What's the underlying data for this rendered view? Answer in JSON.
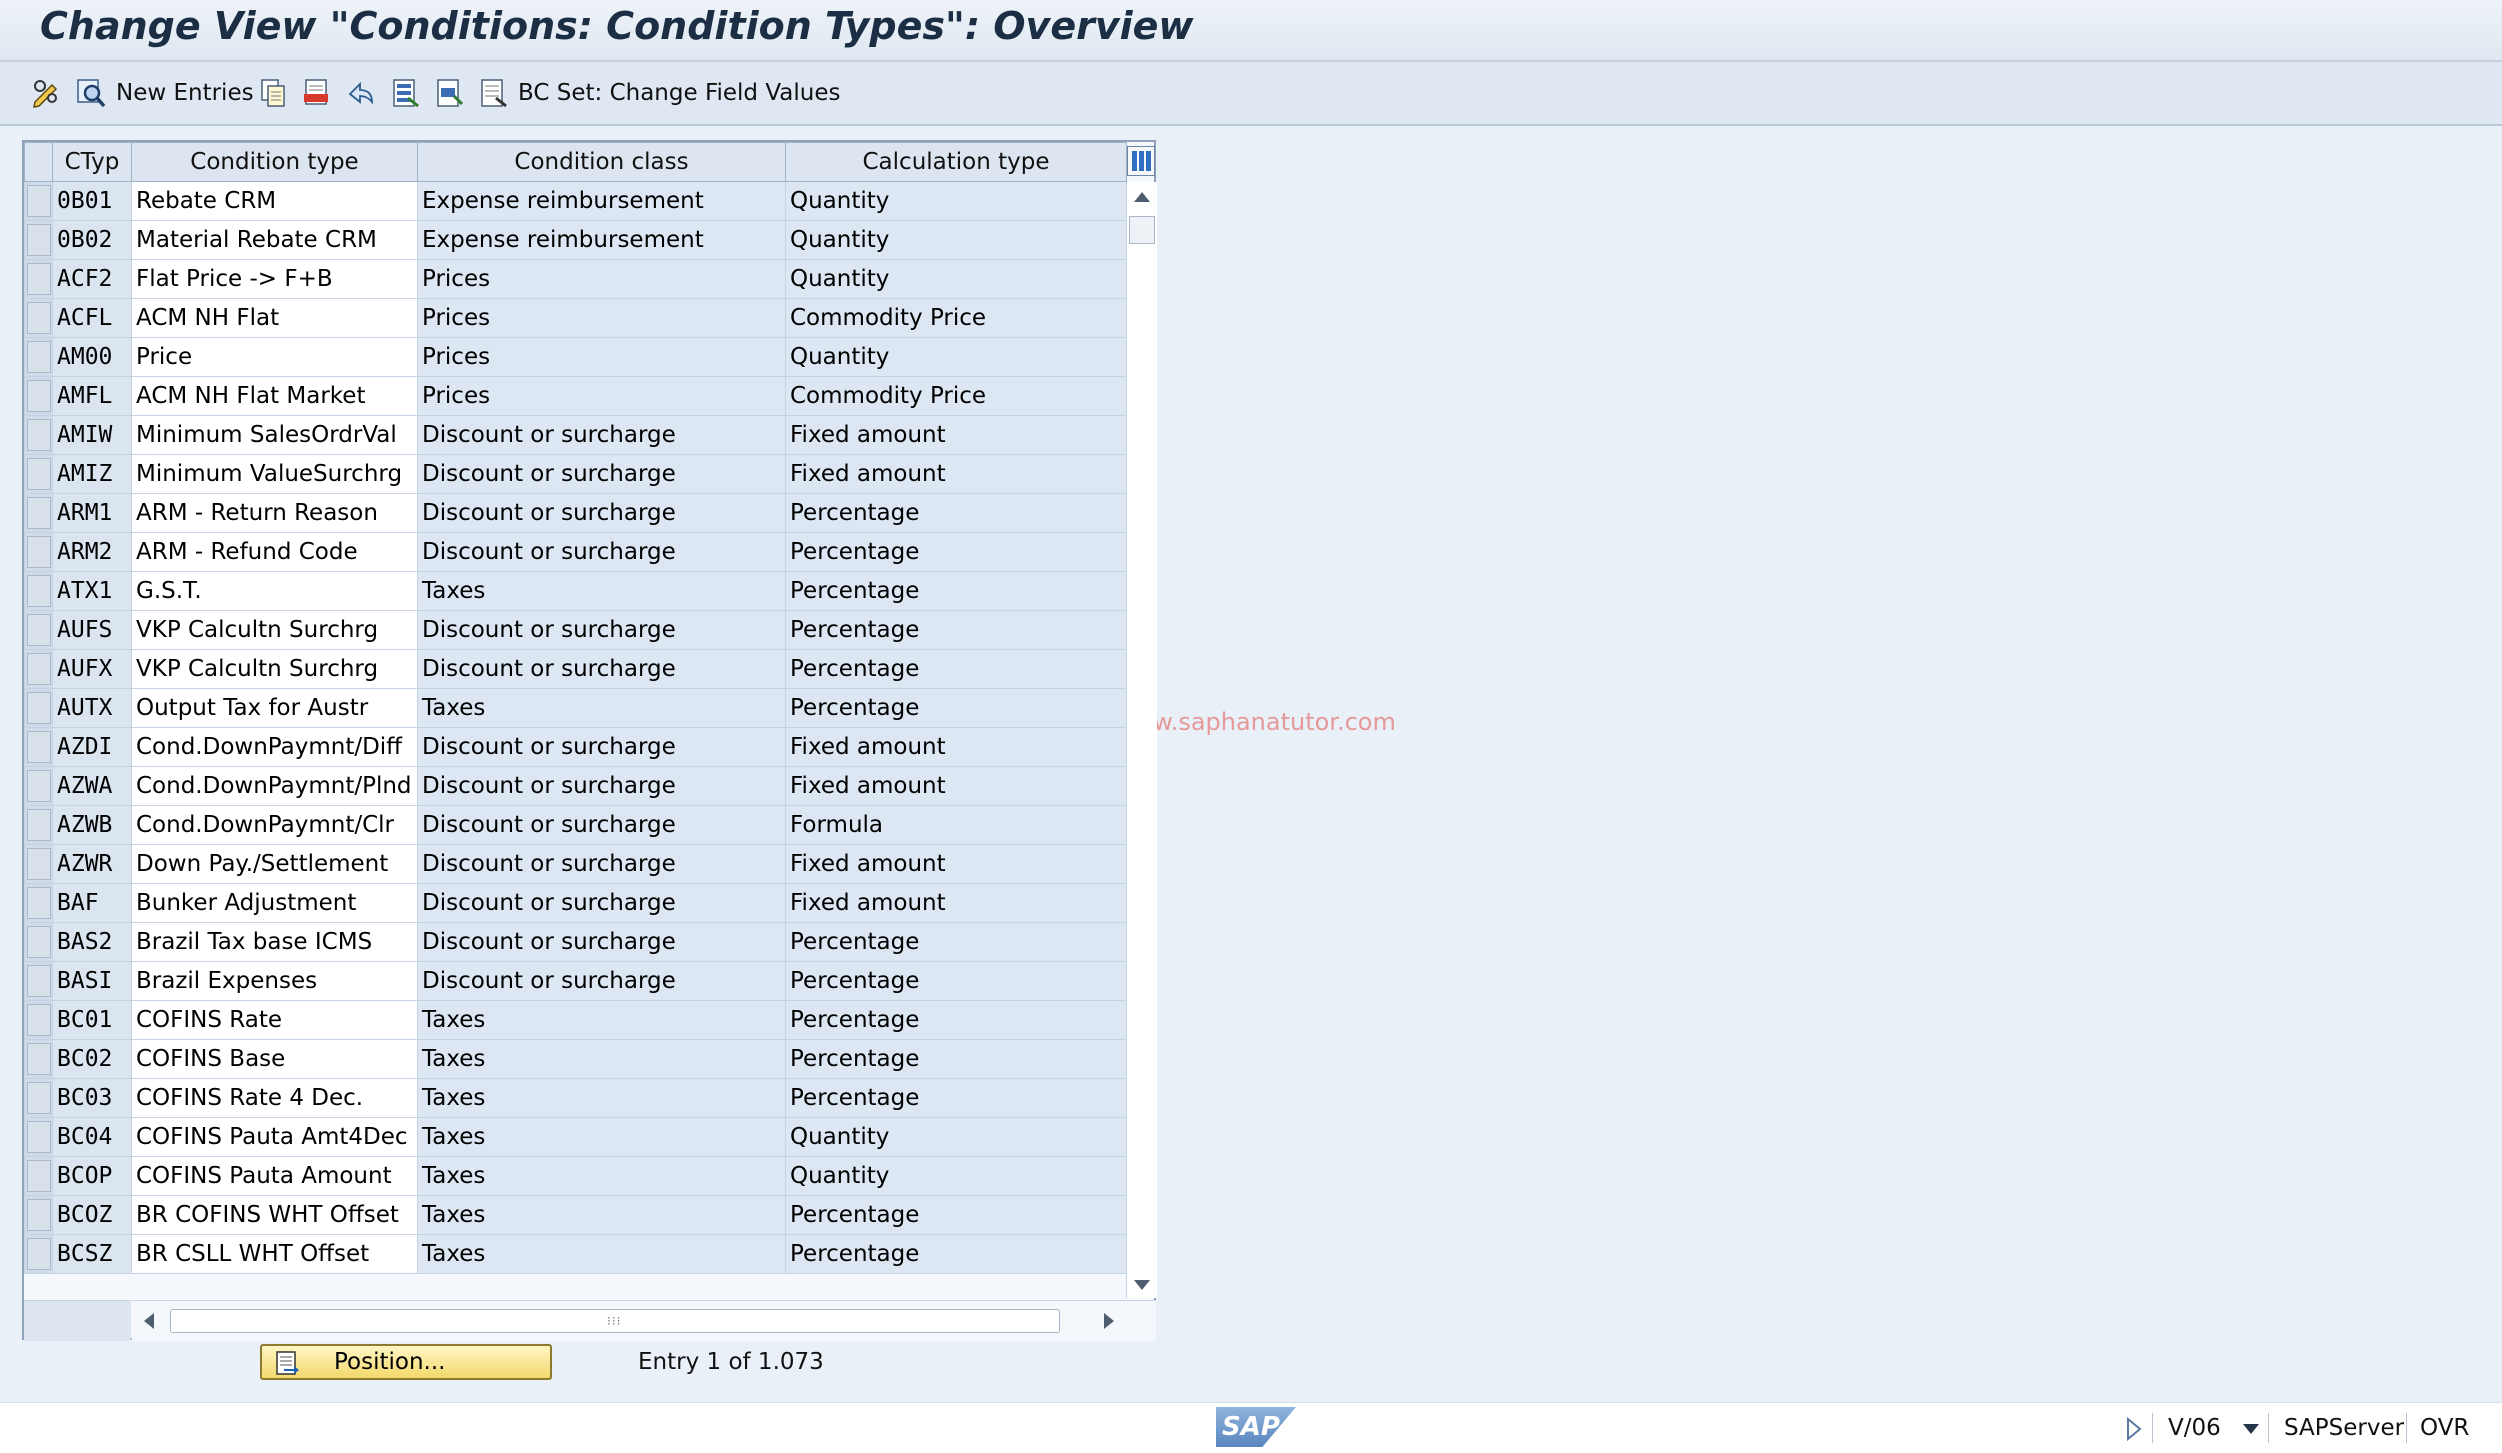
{
  "window": {
    "title": "Change View \"Conditions: Condition Types\": Overview"
  },
  "toolbar": {
    "new_entries_label": "New Entries",
    "bc_set_label": "BC Set: Change Field Values"
  },
  "table": {
    "headers": [
      "CTyp",
      "Condition type",
      "Condition class",
      "Calculation type"
    ],
    "rows": [
      [
        "0B01",
        "Rebate CRM",
        "Expense reimbursement",
        "Quantity"
      ],
      [
        "0B02",
        "Material Rebate CRM",
        "Expense reimbursement",
        "Quantity"
      ],
      [
        "ACF2",
        "Flat Price -> F+B",
        "Prices",
        "Quantity"
      ],
      [
        "ACFL",
        "ACM NH Flat",
        "Prices",
        "Commodity Price"
      ],
      [
        "AM00",
        "Price",
        "Prices",
        "Quantity"
      ],
      [
        "AMFL",
        "ACM NH Flat Market",
        "Prices",
        "Commodity Price"
      ],
      [
        "AMIW",
        "Minimum SalesOrdrVal",
        "Discount or surcharge",
        "Fixed amount"
      ],
      [
        "AMIZ",
        "Minimum ValueSurchrg",
        "Discount or surcharge",
        "Fixed amount"
      ],
      [
        "ARM1",
        "ARM - Return Reason",
        "Discount or surcharge",
        "Percentage"
      ],
      [
        "ARM2",
        "ARM - Refund Code",
        "Discount or surcharge",
        "Percentage"
      ],
      [
        "ATX1",
        "G.S.T.",
        "Taxes",
        "Percentage"
      ],
      [
        "AUFS",
        "VKP Calcultn Surchrg",
        "Discount or surcharge",
        "Percentage"
      ],
      [
        "AUFX",
        "VKP Calcultn Surchrg",
        "Discount or surcharge",
        "Percentage"
      ],
      [
        "AUTX",
        "Output Tax for Austr",
        "Taxes",
        "Percentage"
      ],
      [
        "AZDI",
        "Cond.DownPaymnt/Diff",
        "Discount or surcharge",
        "Fixed amount"
      ],
      [
        "AZWA",
        "Cond.DownPaymnt/Plnd",
        "Discount or surcharge",
        "Fixed amount"
      ],
      [
        "AZWB",
        "Cond.DownPaymnt/Clr",
        "Discount or surcharge",
        "Formula"
      ],
      [
        "AZWR",
        "Down Pay./Settlement",
        "Discount or surcharge",
        "Fixed amount"
      ],
      [
        "BAF",
        "Bunker Adjustment",
        "Discount or surcharge",
        "Fixed amount"
      ],
      [
        "BAS2",
        "Brazil Tax base ICMS",
        "Discount or surcharge",
        "Percentage"
      ],
      [
        "BASI",
        "Brazil Expenses",
        "Discount or surcharge",
        "Percentage"
      ],
      [
        "BC01",
        "COFINS Rate",
        "Taxes",
        "Percentage"
      ],
      [
        "BC02",
        "COFINS Base",
        "Taxes",
        "Percentage"
      ],
      [
        "BC03",
        "COFINS Rate 4 Dec.",
        "Taxes",
        "Percentage"
      ],
      [
        "BC04",
        "COFINS Pauta Amt4Dec",
        "Taxes",
        "Quantity"
      ],
      [
        "BCOP",
        "COFINS Pauta Amount",
        "Taxes",
        "Quantity"
      ],
      [
        "BCOZ",
        "BR COFINS WHT Offset",
        "Taxes",
        "Percentage"
      ],
      [
        "BCSZ",
        "BR CSLL WHT Offset",
        "Taxes",
        "Percentage"
      ]
    ]
  },
  "footer": {
    "position_button_label": "Position...",
    "entry_text": "Entry 1 of 1.073"
  },
  "watermark": "www.saphanatutor.com",
  "statusbar": {
    "logo_text": "SAP",
    "transaction": "V/06",
    "server": "SAPServer",
    "mode": "OVR"
  },
  "colors": {
    "title_text": "#1c2e44",
    "button_yellow": "#f3d86b",
    "row_white": "#ffffff",
    "row_blue": "#dce7f3"
  }
}
